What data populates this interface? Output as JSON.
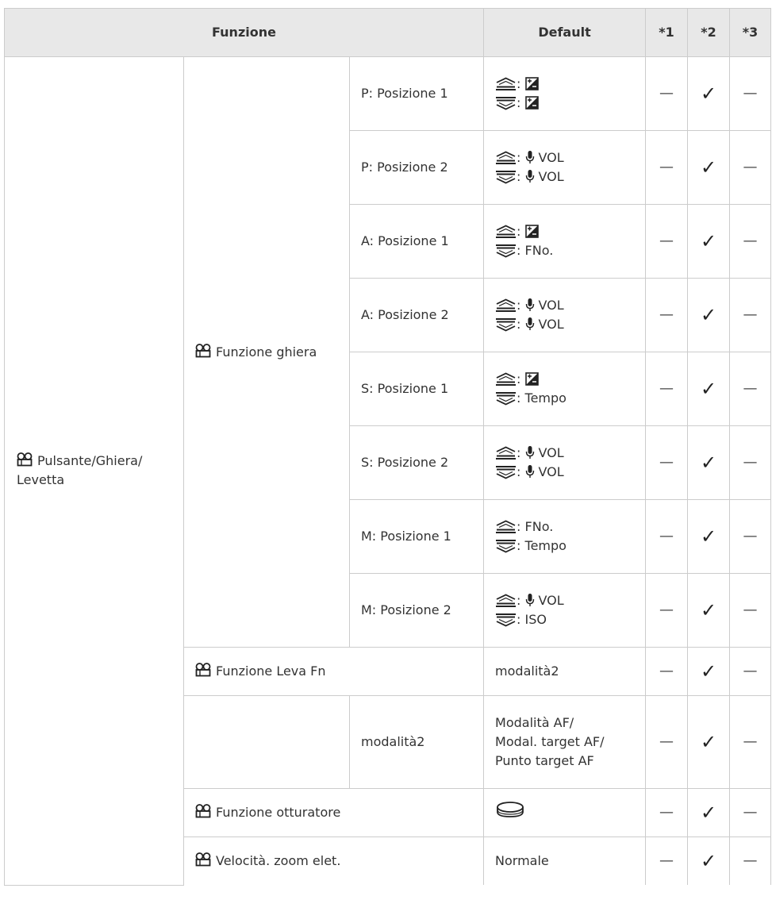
{
  "headers": {
    "function": "Funzione",
    "default": "Default",
    "c1": "*1",
    "c2": "*2",
    "c3": "*3"
  },
  "group_label": "Pulsante/Ghiera/ Levetta",
  "subgroup_label": "Funzione ghiera",
  "check_mark": "✓",
  "dash_mark": "—",
  "vol_text": "VOL",
  "colon": ":",
  "rows": [
    {
      "mode": "P: Posizione 1",
      "front": "",
      "rear": ""
    },
    {
      "mode": "P: Posizione 2",
      "front": "VOL",
      "rear": "VOL"
    },
    {
      "mode": "A: Posizione 1",
      "front": "",
      "rear": "FNo."
    },
    {
      "mode": "A: Posizione 2",
      "front": "VOL",
      "rear": "VOL"
    },
    {
      "mode": "S: Posizione 1",
      "front": "",
      "rear": "Tempo"
    },
    {
      "mode": "S: Posizione 2",
      "front": "VOL",
      "rear": "VOL"
    },
    {
      "mode": "M: Posizione 1",
      "front": "FNo.",
      "rear": "Tempo"
    },
    {
      "mode": "M: Posizione 2",
      "front": "VOL",
      "rear": "ISO"
    }
  ],
  "fn_lever": {
    "label": "Funzione Leva Fn",
    "default": "modalità2"
  },
  "mode2": {
    "label": "modalità2",
    "default": [
      "Modalità AF/",
      "Modal. target AF/",
      "Punto target AF"
    ]
  },
  "shutter": {
    "label": "Funzione otturatore",
    "icon": "shutter-button-icon"
  },
  "zoom": {
    "label": "Velocità. zoom elet.",
    "default": "Normale"
  },
  "icons": [
    "movie-camera-icon",
    "front-dial-icon",
    "rear-dial-icon",
    "microphone-icon",
    "exposure-compensation-icon",
    "shutter-button-icon"
  ]
}
